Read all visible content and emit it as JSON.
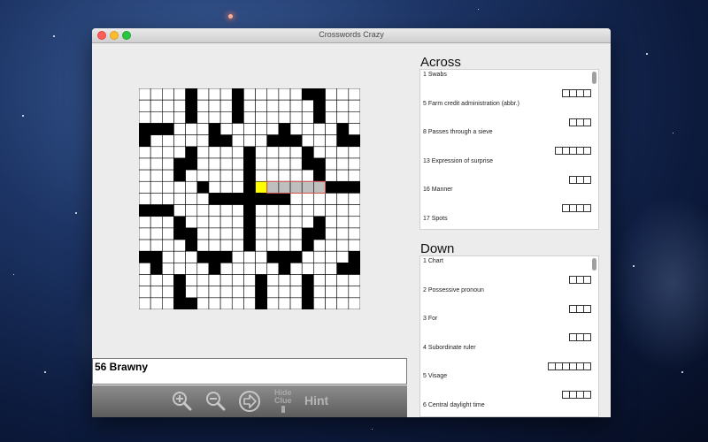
{
  "window": {
    "title": "Crosswords Crazy"
  },
  "current_clue": "56 Brawny",
  "toolbar": {
    "hide_clue_line1": "Hide",
    "hide_clue_line2": "Clue",
    "hint": "Hint"
  },
  "across": {
    "title": "Across",
    "items": [
      {
        "label": "1 Swabs",
        "boxes": 4
      },
      {
        "label": "5 Farm credit administration (abbr.)",
        "boxes": 3
      },
      {
        "label": "8 Passes through a sieve",
        "boxes": 5
      },
      {
        "label": "13 Expression of surprise",
        "boxes": 3
      },
      {
        "label": "16 Manner",
        "boxes": 4
      },
      {
        "label": "17 Spots",
        "boxes": 0
      }
    ]
  },
  "down": {
    "title": "Down",
    "items": [
      {
        "label": "1 Chart",
        "boxes": 3
      },
      {
        "label": "2 Possessive pronoun",
        "boxes": 3
      },
      {
        "label": "3 For",
        "boxes": 3
      },
      {
        "label": "4 Subordinate ruler",
        "boxes": 6
      },
      {
        "label": "5 Visage",
        "boxes": 4
      },
      {
        "label": "6 Central daylight time",
        "boxes": 0
      }
    ]
  },
  "puzzle": {
    "size": 19,
    "black_cells": [
      [
        0,
        4
      ],
      [
        0,
        8
      ],
      [
        0,
        14
      ],
      [
        0,
        15
      ],
      [
        1,
        4
      ],
      [
        1,
        8
      ],
      [
        1,
        15
      ],
      [
        2,
        4
      ],
      [
        2,
        8
      ],
      [
        2,
        15
      ],
      [
        3,
        0
      ],
      [
        3,
        1
      ],
      [
        3,
        2
      ],
      [
        3,
        6
      ],
      [
        3,
        12
      ],
      [
        3,
        17
      ],
      [
        4,
        0
      ],
      [
        4,
        6
      ],
      [
        4,
        7
      ],
      [
        4,
        11
      ],
      [
        4,
        12
      ],
      [
        4,
        13
      ],
      [
        4,
        17
      ],
      [
        4,
        18
      ],
      [
        5,
        4
      ],
      [
        5,
        9
      ],
      [
        5,
        14
      ],
      [
        6,
        3
      ],
      [
        6,
        4
      ],
      [
        6,
        9
      ],
      [
        6,
        14
      ],
      [
        6,
        15
      ],
      [
        7,
        3
      ],
      [
        7,
        9
      ],
      [
        7,
        15
      ],
      [
        8,
        5
      ],
      [
        8,
        9
      ],
      [
        8,
        16
      ],
      [
        8,
        17
      ],
      [
        8,
        18
      ],
      [
        9,
        6
      ],
      [
        9,
        7
      ],
      [
        9,
        8
      ],
      [
        9,
        9
      ],
      [
        9,
        10
      ],
      [
        9,
        11
      ],
      [
        9,
        12
      ],
      [
        10,
        0
      ],
      [
        10,
        1
      ],
      [
        10,
        2
      ],
      [
        10,
        9
      ],
      [
        11,
        3
      ],
      [
        11,
        9
      ],
      [
        11,
        15
      ],
      [
        12,
        3
      ],
      [
        12,
        4
      ],
      [
        12,
        9
      ],
      [
        12,
        14
      ],
      [
        12,
        15
      ],
      [
        13,
        4
      ],
      [
        13,
        9
      ],
      [
        13,
        14
      ],
      [
        14,
        0
      ],
      [
        14,
        1
      ],
      [
        14,
        5
      ],
      [
        14,
        6
      ],
      [
        14,
        7
      ],
      [
        14,
        11
      ],
      [
        14,
        12
      ],
      [
        14,
        13
      ],
      [
        14,
        18
      ],
      [
        15,
        1
      ],
      [
        15,
        6
      ],
      [
        15,
        12
      ],
      [
        15,
        17
      ],
      [
        15,
        18
      ],
      [
        16,
        3
      ],
      [
        16,
        10
      ],
      [
        16,
        14
      ],
      [
        17,
        3
      ],
      [
        17,
        10
      ],
      [
        17,
        14
      ],
      [
        18,
        3
      ],
      [
        18,
        4
      ],
      [
        18,
        10
      ],
      [
        18,
        14
      ]
    ],
    "selected_cell": [
      8,
      10
    ],
    "highlighted_cells": [
      [
        8,
        11
      ],
      [
        8,
        12
      ],
      [
        8,
        13
      ],
      [
        8,
        14
      ],
      [
        8,
        15
      ]
    ],
    "colors": {
      "selected": "#ffff00",
      "highlight": "#bfbfbf",
      "highlight_border": "#d9534f",
      "black": "#000000"
    }
  }
}
